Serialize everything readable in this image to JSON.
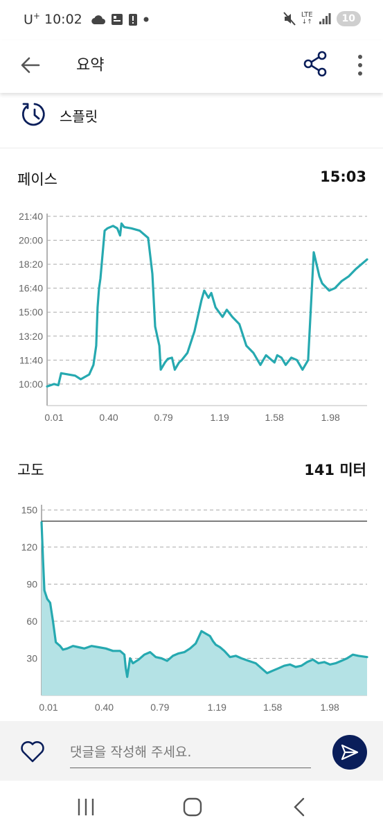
{
  "status_bar": {
    "carrier": "U",
    "carrier_sup": "+",
    "time": "10:02",
    "network": "LTE",
    "battery": "10",
    "icons": [
      "cloud-icon",
      "app-icon",
      "alert-icon",
      "dot-icon",
      "mute-icon",
      "lte-icon",
      "signal-icon",
      "battery-icon"
    ]
  },
  "app_bar": {
    "title": "요약",
    "icons": [
      "back-arrow-icon",
      "share-icon",
      "more-vert-icon"
    ]
  },
  "splits": {
    "label": "스플릿",
    "icon": "split-timer-icon"
  },
  "pace": {
    "title": "페이스",
    "value": "15:03"
  },
  "elevation": {
    "title": "고도",
    "value": "141 미터"
  },
  "chart_data": [
    {
      "type": "line",
      "title": "페이스",
      "color": "#26a9b0",
      "x_ticks": [
        "0.01",
        "0.40",
        "0.79",
        "1.19",
        "1.58",
        "1.98"
      ],
      "x_tick_values": [
        0.01,
        0.4,
        0.79,
        1.19,
        1.58,
        1.98
      ],
      "y_ticks": [
        "21:40",
        "20:00",
        "18:20",
        "16:40",
        "15:00",
        "13:20",
        "11:40",
        "10:00"
      ],
      "y_tick_values": [
        1300,
        1200,
        1100,
        1000,
        900,
        800,
        700,
        600
      ],
      "xlim": [
        0.0,
        2.28
      ],
      "ylim": [
        510,
        1300
      ],
      "grid": "dashed horizontal",
      "x": [
        0.0,
        0.05,
        0.08,
        0.1,
        0.15,
        0.2,
        0.24,
        0.3,
        0.33,
        0.35,
        0.36,
        0.37,
        0.38,
        0.41,
        0.43,
        0.47,
        0.5,
        0.52,
        0.53,
        0.55,
        0.6,
        0.66,
        0.72,
        0.75,
        0.77,
        0.8,
        0.81,
        0.84,
        0.86,
        0.89,
        0.91,
        0.94,
        0.96,
        1.0,
        1.05,
        1.1,
        1.12,
        1.15,
        1.17,
        1.2,
        1.25,
        1.28,
        1.32,
        1.37,
        1.42,
        1.47,
        1.52,
        1.56,
        1.62,
        1.64,
        1.67,
        1.7,
        1.74,
        1.78,
        1.82,
        1.86,
        1.9,
        1.94,
        1.96,
        2.01,
        2.05,
        2.1,
        2.15,
        2.2,
        2.28
      ],
      "y": [
        590,
        600,
        595,
        645,
        640,
        635,
        620,
        640,
        680,
        760,
        920,
        1000,
        1040,
        1240,
        1250,
        1260,
        1250,
        1220,
        1270,
        1255,
        1250,
        1240,
        1210,
        1060,
        840,
        760,
        660,
        690,
        705,
        710,
        660,
        690,
        700,
        730,
        820,
        950,
        990,
        960,
        980,
        920,
        880,
        910,
        880,
        850,
        760,
        730,
        680,
        720,
        690,
        720,
        710,
        680,
        710,
        700,
        660,
        700,
        1150,
        1050,
        1020,
        990,
        1000,
        1030,
        1050,
        1080,
        1120
      ]
    },
    {
      "type": "area",
      "title": "고도",
      "color": "#26a9b0",
      "fill": "#b4e2e5",
      "reference_line": 141,
      "x_ticks": [
        "0.01",
        "0.40",
        "0.79",
        "1.19",
        "1.58",
        "1.98"
      ],
      "x_tick_values": [
        0.01,
        0.4,
        0.79,
        1.19,
        1.58,
        1.98
      ],
      "y_ticks": [
        "150",
        "120",
        "90",
        "60",
        "30"
      ],
      "y_tick_values": [
        150,
        120,
        90,
        60,
        30
      ],
      "xlim": [
        0.0,
        2.28
      ],
      "ylim": [
        0,
        152
      ],
      "grid": "dashed horizontal",
      "x": [
        0.0,
        0.01,
        0.02,
        0.04,
        0.06,
        0.08,
        0.1,
        0.13,
        0.15,
        0.18,
        0.22,
        0.26,
        0.3,
        0.35,
        0.4,
        0.45,
        0.5,
        0.55,
        0.58,
        0.59,
        0.6,
        0.62,
        0.64,
        0.68,
        0.72,
        0.76,
        0.8,
        0.84,
        0.88,
        0.92,
        0.96,
        1.0,
        1.04,
        1.08,
        1.12,
        1.15,
        1.18,
        1.2,
        1.22,
        1.25,
        1.28,
        1.32,
        1.36,
        1.4,
        1.45,
        1.5,
        1.54,
        1.58,
        1.62,
        1.66,
        1.7,
        1.74,
        1.78,
        1.82,
        1.86,
        1.9,
        1.94,
        1.98,
        2.02,
        2.06,
        2.1,
        2.14,
        2.18,
        2.22,
        2.28
      ],
      "y": [
        140,
        110,
        85,
        78,
        75,
        60,
        43,
        40,
        37,
        38,
        40,
        39,
        38,
        40,
        39,
        38,
        36,
        36,
        33,
        22,
        15,
        30,
        26,
        29,
        33,
        35,
        31,
        30,
        28,
        32,
        34,
        35,
        38,
        42,
        52,
        50,
        48,
        44,
        41,
        39,
        36,
        31,
        32,
        30,
        28,
        26,
        22,
        18,
        20,
        22,
        24,
        25,
        23,
        24,
        27,
        29,
        26,
        27,
        25,
        26,
        28,
        30,
        33,
        32,
        31
      ]
    }
  ],
  "comment": {
    "placeholder": "댓글을 작성해 주세요.",
    "icons": [
      "heart-icon",
      "send-icon"
    ]
  },
  "nav_bar": {
    "icons": [
      "recent-apps-icon",
      "home-icon",
      "back-icon"
    ]
  }
}
